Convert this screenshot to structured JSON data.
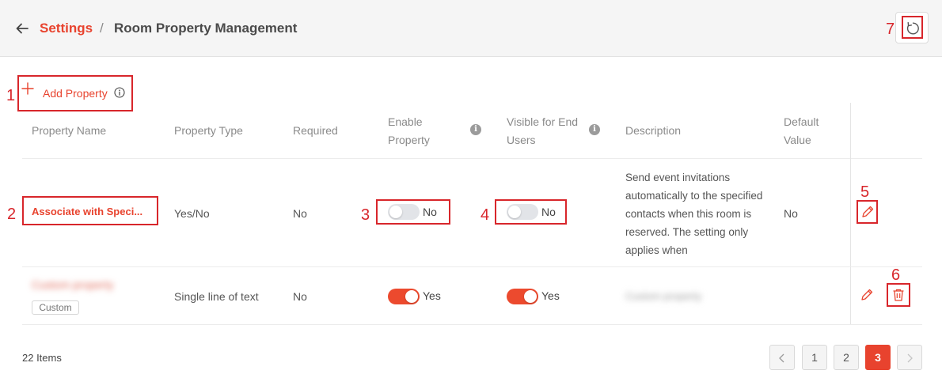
{
  "breadcrumb": {
    "parent": "Settings",
    "separator": "/",
    "current": "Room Property Management"
  },
  "toolbar": {
    "add_label": "Add Property"
  },
  "table": {
    "columns": [
      "Property Name",
      "Property Type",
      "Required",
      "Enable Property",
      "Visible for End Users",
      "Description",
      "Default Value"
    ],
    "column_lines": {
      "enable": [
        "Enable",
        "Property"
      ],
      "visible": [
        "Visible for End",
        "Users"
      ],
      "default": [
        "Default",
        "Value"
      ]
    },
    "rows": [
      {
        "name": "Associate with Speci...",
        "type": "Yes/No",
        "required": "No",
        "enable": "No",
        "visible": "No",
        "description": "Send event invitations automatically to the specified contacts when this room is reserved. The setting only applies when",
        "default": "No"
      },
      {
        "name": "Custom property",
        "tag": "Custom",
        "type": "Single line of text",
        "required": "No",
        "enable": "Yes",
        "visible": "Yes",
        "description": "Custom property",
        "default": ""
      }
    ]
  },
  "pagination": {
    "total": "22 Items",
    "pages": [
      "1",
      "2",
      "3"
    ],
    "current": "3",
    "prev_icon": "chevron-left-icon",
    "next_icon": "chevron-right-icon"
  },
  "markers": [
    "1",
    "2",
    "3",
    "4",
    "5",
    "6",
    "7"
  ],
  "colors": {
    "accent": "#e8432e",
    "annotation": "#d8262b",
    "toggle_off": "#e2e4e8",
    "toggle_on": "#ec4a2e"
  }
}
